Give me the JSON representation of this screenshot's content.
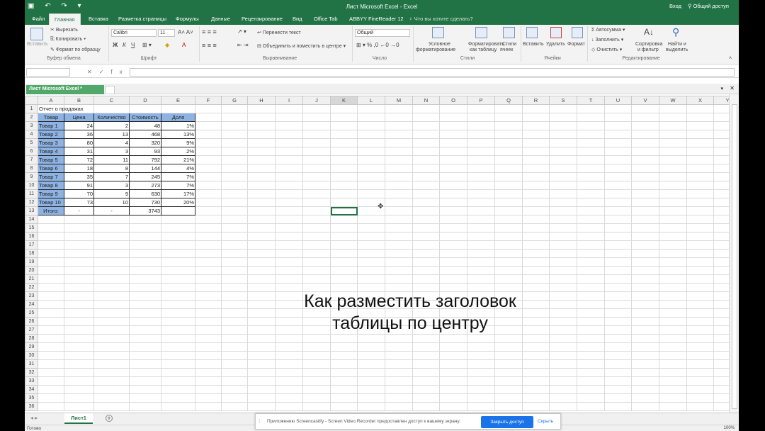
{
  "window": {
    "title": "Лист Microsoft Excel - Excel",
    "signin": "Вход",
    "share": "Общий доступ"
  },
  "ribbon_tabs": [
    "Файл",
    "Главная",
    "Вставка",
    "Разметка страницы",
    "Формулы",
    "Данные",
    "Рецензирование",
    "Вид",
    "Office Tab",
    "ABBYY FineReader 12"
  ],
  "tell_me": "Что вы хотите сделать?",
  "clipboard": {
    "paste": "Вставить",
    "cut": "Вырезать",
    "copy": "Копировать",
    "format_painter": "Формат по образцу",
    "group": "Буфер обмена"
  },
  "font": {
    "name": "Calibri",
    "size": "11",
    "group": "Шрифт"
  },
  "alignment": {
    "wrap": "Перенести текст",
    "merge": "Объединить и поместить в центре",
    "group": "Выравнивание"
  },
  "number": {
    "format": "Общий",
    "group": "Число"
  },
  "styles": {
    "conditional_1": "Условное",
    "conditional_2": "форматирование",
    "format_table_1": "Форматировать",
    "format_table_2": "как таблицу",
    "cell_styles_1": "Стили",
    "cell_styles_2": "ячеек",
    "group": "Стили"
  },
  "cells": {
    "insert": "Вставить",
    "delete": "Удалить",
    "format": "Формат",
    "group": "Ячейки"
  },
  "editing": {
    "autosum": "Автосумма",
    "fill": "Заполнить",
    "clear": "Очистить",
    "sort_1": "Сортировка",
    "sort_2": "и фильтр",
    "find_1": "Найти и",
    "find_2": "выделить",
    "group": "Редактирование"
  },
  "formula_bar": {
    "fx": "fx",
    "value": ""
  },
  "doc_tab": "Лист Microsoft Excel *",
  "columns": [
    "A",
    "B",
    "C",
    "D",
    "E",
    "F",
    "G",
    "H",
    "I",
    "J",
    "K",
    "L",
    "M",
    "N",
    "O",
    "P",
    "Q",
    "R",
    "S",
    "T",
    "U",
    "V",
    "W",
    "X",
    "Y"
  ],
  "selected_column": "K",
  "rows": 36,
  "table": {
    "title": "Отчет о продажах",
    "headers": [
      "Товар",
      "Цена",
      "Количество",
      "Стоимость",
      "Доля"
    ],
    "rows": [
      [
        "Товар 1",
        "24",
        "2",
        "48",
        "1%"
      ],
      [
        "Товар 2",
        "36",
        "13",
        "468",
        "13%"
      ],
      [
        "Товар 3",
        "80",
        "4",
        "320",
        "9%"
      ],
      [
        "Товар 4",
        "31",
        "3",
        "93",
        "2%"
      ],
      [
        "Товар 5",
        "72",
        "11",
        "792",
        "21%"
      ],
      [
        "Товар 6",
        "18",
        "8",
        "144",
        "4%"
      ],
      [
        "Товар 7",
        "35",
        "7",
        "245",
        "7%"
      ],
      [
        "Товар 8",
        "91",
        "3",
        "273",
        "7%"
      ],
      [
        "Товар 9",
        "70",
        "9",
        "630",
        "17%"
      ],
      [
        "Товар 10",
        "73",
        "10",
        "730",
        "20%"
      ]
    ],
    "total": [
      "Итого:",
      "-",
      "-",
      "3743",
      ""
    ]
  },
  "sheet_tab": "Лист1",
  "status": {
    "ready": "Готово",
    "zoom": "100%"
  },
  "notification": {
    "text": "Приложению Screencastify - Screen Video Recorder предоставлен доступ к вашему экрану.",
    "button": "Закрыть доступ",
    "link": "Скрыть"
  },
  "overlay": {
    "line1": "Как разместить заголовок",
    "line2": "таблицы по центру"
  }
}
